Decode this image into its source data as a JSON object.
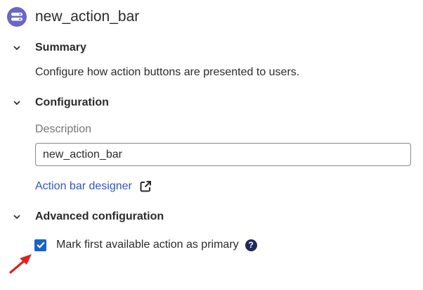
{
  "header": {
    "title": "new_action_bar",
    "icon": "action-bar-icon",
    "icon_color": "#6b65c7"
  },
  "sections": {
    "summary": {
      "title": "Summary",
      "text": "Configure how action buttons are presented to users."
    },
    "configuration": {
      "title": "Configuration",
      "description_label": "Description",
      "description_value": "new_action_bar",
      "designer_link": "Action bar designer"
    },
    "advanced": {
      "title": "Advanced configuration",
      "checkbox_label": "Mark first available action as primary",
      "checkbox_checked": true,
      "help_glyph": "?"
    }
  },
  "colors": {
    "link": "#2f56c4",
    "checkbox": "#1763c9",
    "annotation_arrow": "#e02020"
  }
}
